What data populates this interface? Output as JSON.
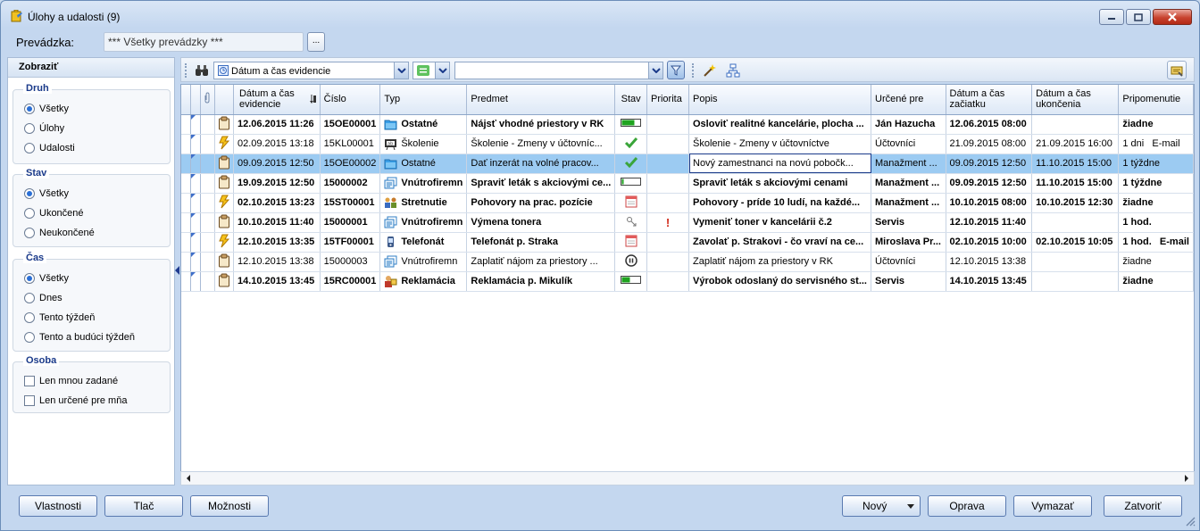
{
  "window": {
    "title": "Úlohy a udalosti (9)"
  },
  "topbar": {
    "label": "Prevádzka:",
    "value": "*** Všetky prevádzky ***",
    "browse_label": "..."
  },
  "filters": {
    "header": "Zobraziť",
    "druh": {
      "title": "Druh",
      "options": [
        "Všetky",
        "Úlohy",
        "Udalosti"
      ],
      "selected": 0
    },
    "stav": {
      "title": "Stav",
      "options": [
        "Všetky",
        "Ukončené",
        "Neukončené"
      ],
      "selected": 0
    },
    "cas": {
      "title": "Čas",
      "options": [
        "Všetky",
        "Dnes",
        "Tento týždeň",
        "Tento a budúci týždeň"
      ],
      "selected": 0
    },
    "osoba": {
      "title": "Osoba",
      "checks": [
        "Len mnou zadané",
        "Len určené pre mňa"
      ]
    }
  },
  "toolbar": {
    "sort_field": "Dátum a čas evidencie",
    "search_value": ""
  },
  "columns": [
    "Dátum a čas evidencie",
    "Číslo",
    "Typ",
    "Predmet",
    "Stav",
    "Priorita",
    "Popis",
    "Určené pre",
    "Dátum a čas začiatku",
    "Dátum a čas ukončenia",
    "Pripomenutie"
  ],
  "rows": [
    {
      "kind": "task",
      "bold": true,
      "datum": "12.06.2015 11:26",
      "cislo": "15OE00001",
      "typ": "Ostatné",
      "typ_icon": "folder-icon",
      "predmet": "Nájsť vhodné priestory v RK",
      "stav": "progress",
      "stav_value": 0.7,
      "priorita": "",
      "popis": "Osloviť realitné kancelárie, plocha ...",
      "urcene": "Ján Hazucha",
      "zaciatok": "12.06.2015 08:00",
      "ukoncenie": "",
      "pripomenutie": "žiadne"
    },
    {
      "kind": "event",
      "bold": false,
      "datum": "02.09.2015 13:18",
      "cislo": "15KL00001",
      "typ": "Školenie",
      "typ_icon": "training-icon",
      "predmet": "Školenie - Zmeny v účtovníc...",
      "stav": "done",
      "priorita": "",
      "popis": "Školenie - Zmeny v účtovníctve",
      "urcene": "Účtovníci",
      "zaciatok": "21.09.2015 08:00",
      "ukoncenie": "21.09.2015 16:00",
      "pripomenutie": "1 dni   E-mail"
    },
    {
      "kind": "task",
      "bold": false,
      "selected": true,
      "datum": "09.09.2015 12:50",
      "cislo": "15OE00002",
      "typ": "Ostatné",
      "typ_icon": "folder-icon",
      "predmet": "Dať inzerát na volné pracov...",
      "stav": "done",
      "priorita": "",
      "popis": "Nový zamestnanci na novú pobočk...",
      "urcene": "Manažment ...",
      "zaciatok": "09.09.2015 12:50",
      "ukoncenie": "11.10.2015 15:00",
      "pripomenutie": "1 týždne"
    },
    {
      "kind": "task",
      "bold": true,
      "datum": "19.09.2015 12:50",
      "cislo": "15000002",
      "typ": "Vnútrofiremn",
      "typ_icon": "internal-icon",
      "predmet": "Spraviť leták s akciovými ce...",
      "stav": "progress",
      "stav_value": 0.1,
      "priorita": "",
      "popis": "Spraviť leták s akciovými cenami",
      "urcene": "Manažment ...",
      "zaciatok": "09.09.2015 12:50",
      "ukoncenie": "11.10.2015 15:00",
      "pripomenutie": "1 týždne"
    },
    {
      "kind": "event",
      "bold": true,
      "datum": "02.10.2015 13:23",
      "cislo": "15ST00001",
      "typ": "Stretnutie",
      "typ_icon": "meeting-icon",
      "predmet": "Pohovory na prac. pozície",
      "stav": "calendar",
      "priorita": "",
      "popis": "Pohovory - príde 10 ludí, na každé...",
      "urcene": "Manažment ...",
      "zaciatok": "10.10.2015 08:00",
      "ukoncenie": "10.10.2015 12:30",
      "pripomenutie": "žiadne"
    },
    {
      "kind": "task",
      "bold": true,
      "datum": "10.10.2015 11:40",
      "cislo": "15000001",
      "typ": "Vnútrofiremn",
      "typ_icon": "internal-icon",
      "predmet": "Výmena tonera",
      "stav": "reassign",
      "priorita": "!",
      "popis": "Vymeniť toner v kancelárii č.2",
      "urcene": "Servis",
      "zaciatok": "12.10.2015 11:40",
      "ukoncenie": "",
      "pripomenutie": "1 hod."
    },
    {
      "kind": "event",
      "bold": true,
      "datum": "12.10.2015 13:35",
      "cislo": "15TF00001",
      "typ": "Telefonát",
      "typ_icon": "phone-icon",
      "predmet": "Telefonát p. Straka",
      "stav": "calendar",
      "priorita": "",
      "popis": "Zavolať p. Strakovi - čo vraví na ce...",
      "urcene": "Miroslava Pr...",
      "zaciatok": "02.10.2015 10:00",
      "ukoncenie": "02.10.2015 10:05",
      "pripomenutie": "1 hod.   E-mail"
    },
    {
      "kind": "task",
      "bold": false,
      "datum": "12.10.2015 13:38",
      "cislo": "15000003",
      "typ": "Vnútrofiremn",
      "typ_icon": "internal-icon",
      "predmet": "Zaplatiť nájom za priestory ...",
      "stav": "paused",
      "priorita": "",
      "popis": "Zaplatiť nájom za priestory v RK",
      "urcene": "Účtovníci",
      "zaciatok": "12.10.2015 13:38",
      "ukoncenie": "",
      "pripomenutie": "žiadne"
    },
    {
      "kind": "task",
      "bold": true,
      "datum": "14.10.2015 13:45",
      "cislo": "15RC00001",
      "typ": "Reklamácia",
      "typ_icon": "complaint-icon",
      "predmet": "Reklamácia p. Mikulík",
      "stav": "progress",
      "stav_value": 0.45,
      "priorita": "",
      "popis": "Výrobok odoslaný do servisného st...",
      "urcene": "Servis",
      "zaciatok": "14.10.2015 13:45",
      "ukoncenie": "",
      "pripomenutie": "žiadne"
    }
  ],
  "buttons": {
    "vlastnosti": "Vlastnosti",
    "tlac": "Tlač",
    "moznosti": "Možnosti",
    "novy": "Nový",
    "oprava": "Oprava",
    "vymazat": "Vymazať",
    "zatvorit": "Zatvoriť"
  },
  "colors": {
    "selection": "#9ccbf2",
    "accent": "#1a3a8a",
    "progress": "#1fa31f"
  }
}
